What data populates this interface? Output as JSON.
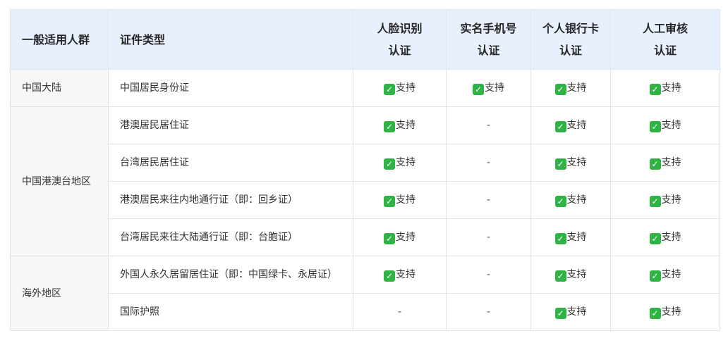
{
  "table": {
    "headers": {
      "group": "一般适用人群",
      "doc_type": "证件类型",
      "face_line1": "人脸识别",
      "face_line2": "认证",
      "phone_line1": "实名手机号",
      "phone_line2": "认证",
      "bank_line1": "个人银行卡",
      "bank_line2": "认证",
      "manual_line1": "人工审核",
      "manual_line2": "认证"
    },
    "groups": {
      "mainland": "中国大陆",
      "hmt": "中国港澳台地区",
      "overseas": "海外地区"
    },
    "rows": [
      {
        "type": "中国居民身份证",
        "face": "支持",
        "phone": "支持",
        "bank": "支持",
        "manual": "支持"
      },
      {
        "type": "港澳居民居住证",
        "face": "支持",
        "phone": "-",
        "bank": "支持",
        "manual": "支持"
      },
      {
        "type": "台湾居民居住证",
        "face": "支持",
        "phone": "-",
        "bank": "支持",
        "manual": "支持"
      },
      {
        "type": "港澳居民来往内地通行证（即：回乡证）",
        "face": "支持",
        "phone": "-",
        "bank": "支持",
        "manual": "支持"
      },
      {
        "type": "台湾居民来往大陆通行证（即：台胞证）",
        "face": "支持",
        "phone": "-",
        "bank": "支持",
        "manual": "支持"
      },
      {
        "type": "外国人永久居留居住证（即：中国绿卡、永居证）",
        "face": "支持",
        "phone": "-",
        "bank": "支持",
        "manual": "支持"
      },
      {
        "type": "国际护照",
        "face": "-",
        "phone": "-",
        "bank": "支持",
        "manual": "支持"
      }
    ],
    "icons": {
      "supported": "check-mark-icon"
    },
    "colors": {
      "header_bg": "#e8f0fe",
      "check_green": "#2fb344",
      "group_bg": "#f7f7f8"
    }
  }
}
